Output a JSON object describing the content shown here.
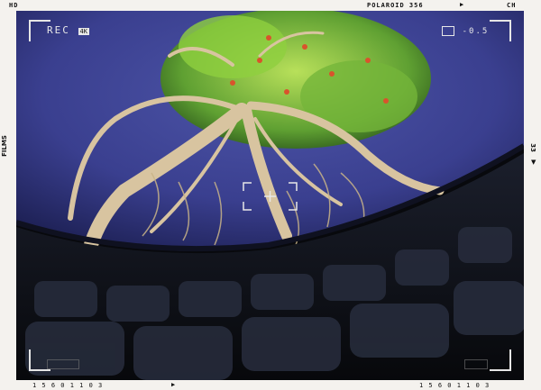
{
  "film_border": {
    "top_left": "HD",
    "top_center": "POLAROID 356",
    "top_right": "CH",
    "left_side": "FILMS",
    "right_side": "33",
    "bottom_left_code": "1 5 6 0 1 1 0 3",
    "bottom_right_code": "1 5 6 0 1 1 0 3"
  },
  "viewfinder": {
    "rec_label": "REC",
    "quality_badge": "4K",
    "exposure_value": "-0.5"
  }
}
